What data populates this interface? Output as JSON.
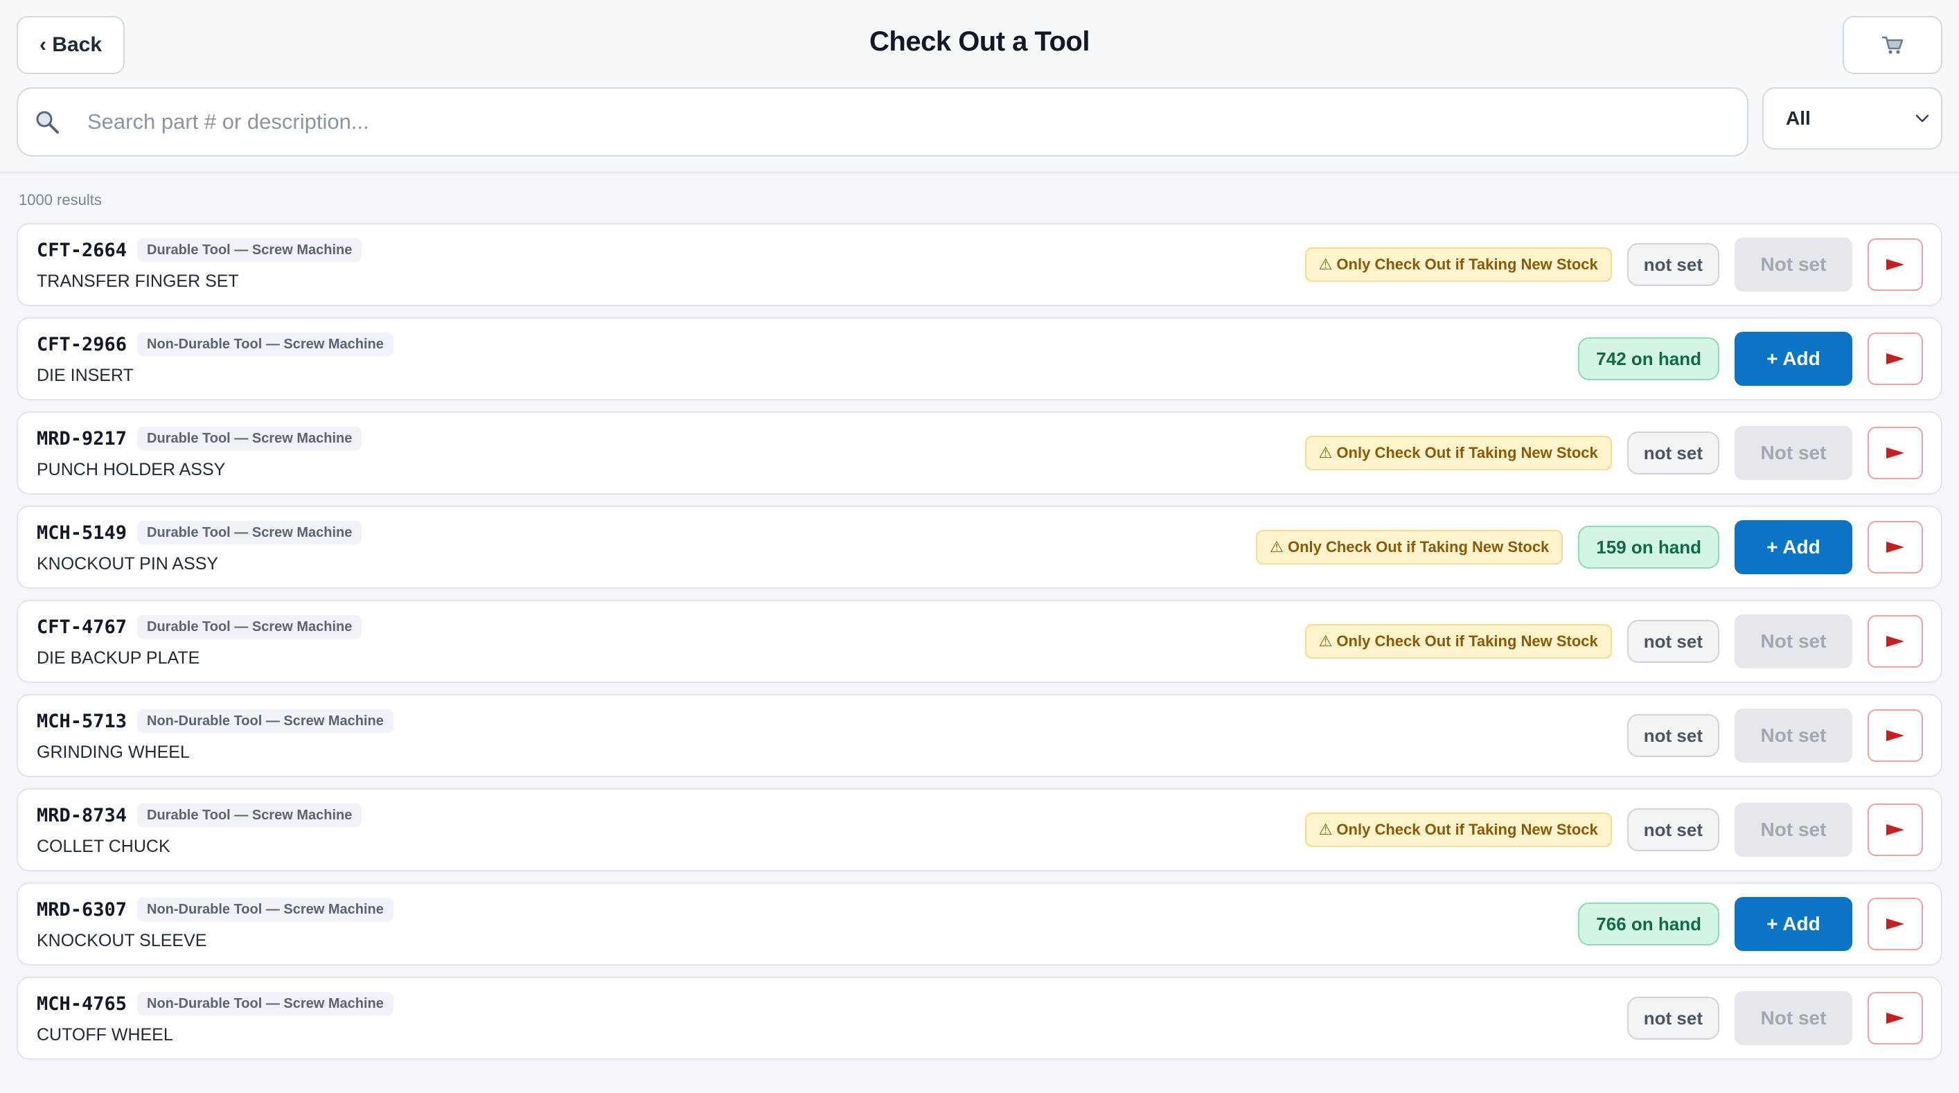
{
  "header": {
    "back_label": "‹ Back",
    "title": "Check Out a Tool",
    "cart_icon": "🛒"
  },
  "search": {
    "placeholder": "Search part # or description...",
    "value": ""
  },
  "filter": {
    "selected": "All"
  },
  "results": {
    "count_label": "1000 results"
  },
  "colors": {
    "primary": "#0b74c4",
    "warning_bg": "#fdf3cd",
    "onhand_bg": "#d4f5e4",
    "flag_red": "#c81e1e"
  },
  "items": [
    {
      "part": "CFT-2664",
      "category": "Durable Tool — Screw Machine",
      "description": "TRANSFER FINGER SET",
      "warning": "⚠ Only Check Out if Taking New Stock",
      "stock": "not set",
      "add": "Not set",
      "add_enabled": false
    },
    {
      "part": "CFT-2966",
      "category": "Non-Durable Tool — Screw Machine",
      "description": "DIE INSERT",
      "warning": "",
      "stock": "742 on hand",
      "add": "+ Add",
      "add_enabled": true
    },
    {
      "part": "MRD-9217",
      "category": "Durable Tool — Screw Machine",
      "description": "PUNCH HOLDER ASSY",
      "warning": "⚠ Only Check Out if Taking New Stock",
      "stock": "not set",
      "add": "Not set",
      "add_enabled": false
    },
    {
      "part": "MCH-5149",
      "category": "Durable Tool — Screw Machine",
      "description": "KNOCKOUT PIN ASSY",
      "warning": "⚠ Only Check Out if Taking New Stock",
      "stock": "159 on hand",
      "add": "+ Add",
      "add_enabled": true
    },
    {
      "part": "CFT-4767",
      "category": "Durable Tool — Screw Machine",
      "description": "DIE BACKUP PLATE",
      "warning": "⚠ Only Check Out if Taking New Stock",
      "stock": "not set",
      "add": "Not set",
      "add_enabled": false
    },
    {
      "part": "MCH-5713",
      "category": "Non-Durable Tool — Screw Machine",
      "description": "GRINDING WHEEL",
      "warning": "",
      "stock": "not set",
      "add": "Not set",
      "add_enabled": false
    },
    {
      "part": "MRD-8734",
      "category": "Durable Tool — Screw Machine",
      "description": "COLLET CHUCK",
      "warning": "⚠ Only Check Out if Taking New Stock",
      "stock": "not set",
      "add": "Not set",
      "add_enabled": false
    },
    {
      "part": "MRD-6307",
      "category": "Non-Durable Tool — Screw Machine",
      "description": "KNOCKOUT SLEEVE",
      "warning": "",
      "stock": "766 on hand",
      "add": "+ Add",
      "add_enabled": true
    },
    {
      "part": "MCH-4765",
      "category": "Non-Durable Tool — Screw Machine",
      "description": "CUTOFF WHEEL",
      "warning": "",
      "stock": "not set",
      "add": "Not set",
      "add_enabled": false
    }
  ]
}
